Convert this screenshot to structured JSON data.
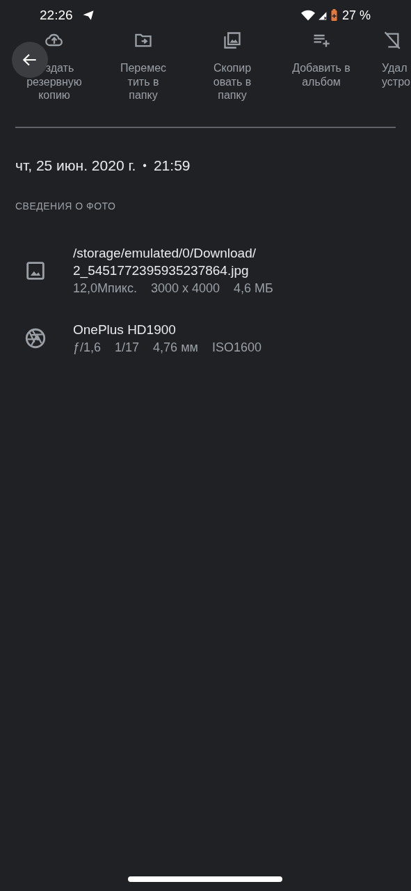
{
  "status_bar": {
    "time": "22:26",
    "battery": "27 %"
  },
  "actions": [
    {
      "lines": [
        "здать",
        "резервную",
        "копию"
      ],
      "cut": false
    },
    {
      "lines": [
        "Перемес",
        "тить в",
        "папку"
      ],
      "cut": false
    },
    {
      "lines": [
        "Скопир",
        "овать в",
        "папку"
      ],
      "cut": false
    },
    {
      "lines": [
        "Добавить в",
        "альбом"
      ],
      "cut": false
    },
    {
      "lines": [
        "Удал",
        "устро"
      ],
      "cut": true
    }
  ],
  "date": "чт, 25 июн. 2020 г.",
  "separator": "•",
  "time": "21:59",
  "section_title": "СВЕДЕНИЯ О ФОТО",
  "details": [
    {
      "title": "/storage/emulated/0/Download/ 2_5451772395935237864.jpg",
      "meta": [
        "12,0Мпикс.",
        "3000 x 4000",
        "4,6 МБ"
      ]
    },
    {
      "title": "OnePlus HD1900",
      "meta": [
        "ƒ/1,6",
        "1/17",
        "4,76 мм",
        "ISO1600"
      ]
    }
  ]
}
